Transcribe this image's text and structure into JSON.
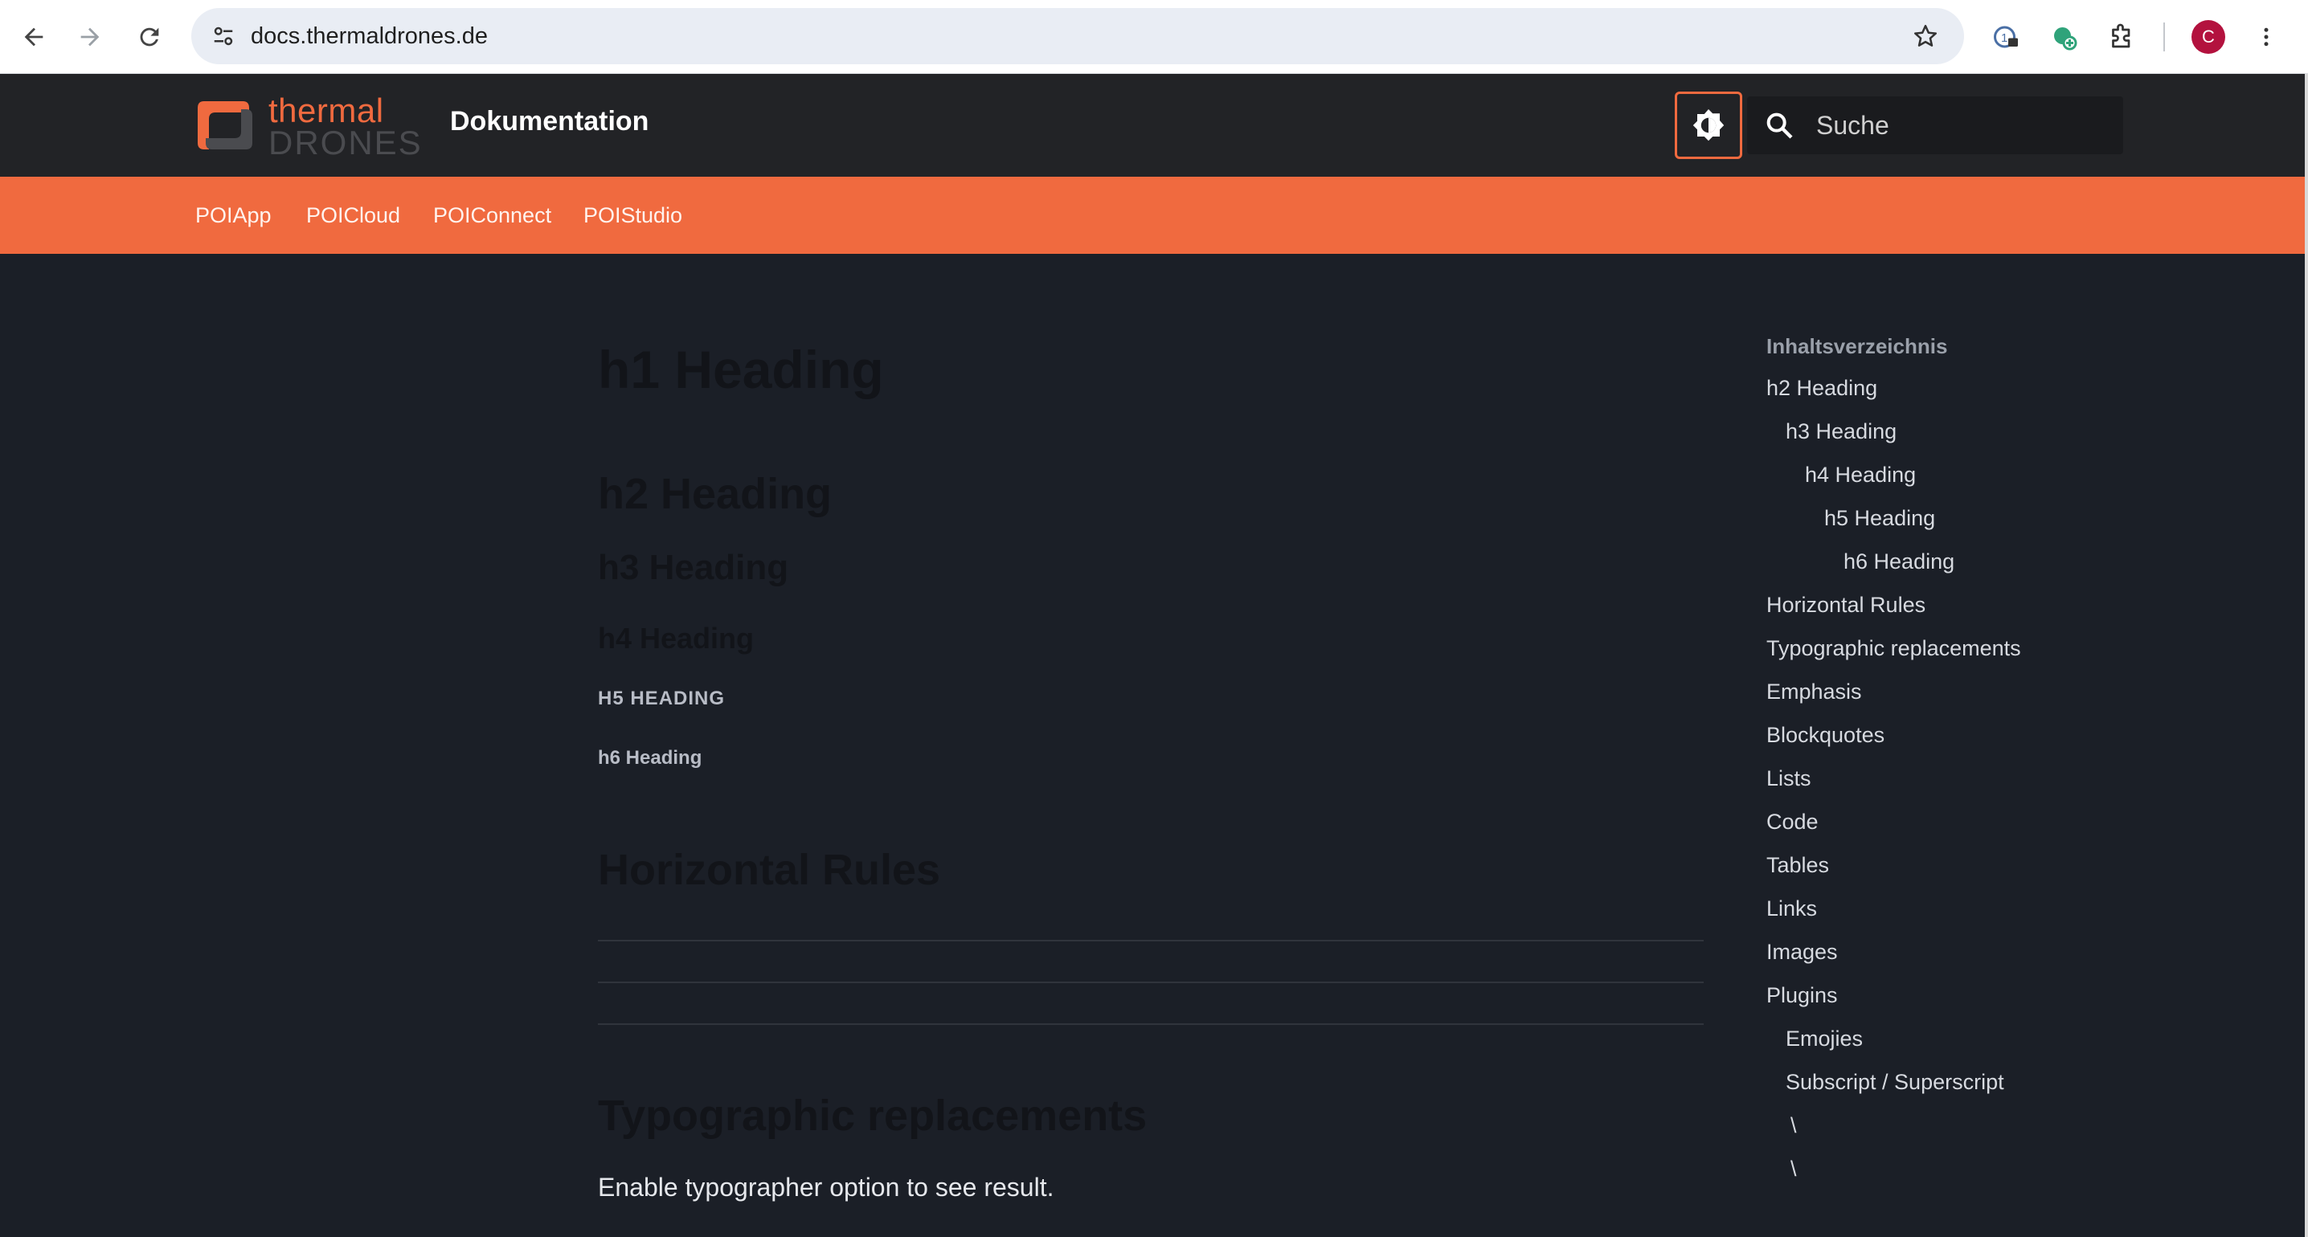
{
  "browser": {
    "url": "docs.thermaldrones.de",
    "profile_initial": "C"
  },
  "header": {
    "logo_top": "thermal",
    "logo_bottom": "DRONES",
    "site_title": "Dokumentation",
    "search_placeholder": "Suche"
  },
  "product_nav": [
    "POIApp",
    "POICloud",
    "POIConnect",
    "POIStudio"
  ],
  "content": {
    "h1": "h1 Heading",
    "h2": "h2 Heading",
    "h3": "h3 Heading",
    "h4": "h4 Heading",
    "h5": "H5 HEADING",
    "h6": "h6 Heading",
    "section_horizontal_rules": "Horizontal Rules",
    "section_typographic": "Typographic replacements",
    "typographer_note": "Enable typographer option to see result."
  },
  "toc": {
    "title": "Inhaltsverzeichnis",
    "items": [
      "h2 Heading",
      "h3 Heading",
      "h4 Heading",
      "h5 Heading",
      "h6 Heading",
      "Horizontal Rules",
      "Typographic replacements",
      "Emphasis",
      "Blockquotes",
      "Lists",
      "Code",
      "Tables",
      "Links",
      "Images",
      "Plugins",
      "Emojies",
      "Subscript / Superscript",
      "\\",
      "\\"
    ]
  },
  "colors": {
    "accent": "#f06a3f",
    "header_bg": "#222326",
    "page_bg": "#1b1f27"
  },
  "icons": {
    "back": "back-arrow-icon",
    "forward": "forward-arrow-icon",
    "reload": "reload-icon",
    "site_info": "site-info-icon",
    "bookmark": "star-icon",
    "theme": "brightness-icon",
    "search": "search-icon"
  }
}
